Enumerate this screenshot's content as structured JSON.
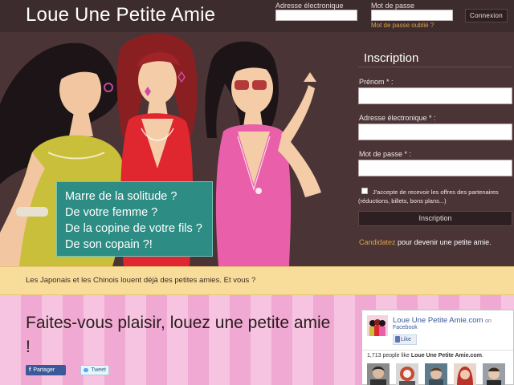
{
  "header": {
    "site_title": "Loue Une Petite Amie",
    "email_label": "Adresse électronique",
    "password_label": "Mot de passe",
    "forgot_password": "Mot de passe oublié ?",
    "login_button": "Connexion"
  },
  "hero": {
    "teal_lines": [
      "Marre de la solitude ?",
      "De votre femme ?",
      "De la copine de votre fils ?",
      "De son copain ?!"
    ]
  },
  "signup": {
    "title": "Inscription",
    "first_name_label": "Prénom * :",
    "email_label": "Adresse électronique * :",
    "password_label": "Mot de passe * :",
    "partner_offers_text": "J'accepte de recevoir les offres des partenaires (réductions, billets, bons plans...)",
    "submit_button": "Inscription",
    "candidate_link": "Candidatez",
    "candidate_suffix": " pour devenir une petite amie."
  },
  "strip": {
    "text": "Les Japonais et les Chinois louent déjà des petites amies. Et vous ?"
  },
  "main": {
    "headline": "Faites-vous plaisir, louez une petite amie !",
    "share_facebook": "Partager",
    "share_twitter": "Tweet"
  },
  "facebook_widget": {
    "page_name": "Loue Une Petite Amie.com",
    "on_word": "on",
    "platform": "Facebook",
    "like_button": "Like",
    "count_prefix": "1,713 people like ",
    "count_page": "Loue Une Petite Amie.com",
    "count_suffix": "."
  },
  "colors": {
    "header_bg": "#3d2c2e",
    "hero_bg": "#4a3436",
    "teal_box": "#2d8c84",
    "strip_bg": "#f8dd9a",
    "stripe_light": "#f6c4e0",
    "stripe_dark": "#efa9d2",
    "link_orange": "#d6a24a",
    "facebook_blue": "#3b5998"
  },
  "icons": {
    "facebook_share": "facebook-icon",
    "twitter_share": "twitter-icon",
    "like": "thumbs-up-icon"
  }
}
